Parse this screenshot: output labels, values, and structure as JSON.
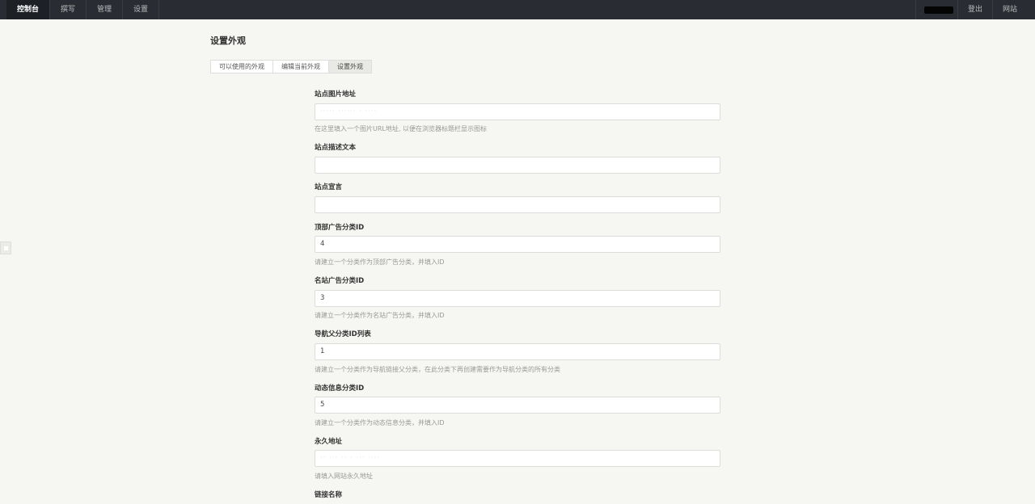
{
  "nav": {
    "left": [
      "控制台",
      "撰写",
      "管理",
      "设置"
    ],
    "right": [
      "登出",
      "网站"
    ]
  },
  "page": {
    "title": "设置外观",
    "tabs": [
      "可以使用的外观",
      "编辑当前外观",
      "设置外观"
    ],
    "active_tab": "设置外观"
  },
  "form": {
    "fields": [
      {
        "label": "站点图片地址",
        "value": "",
        "help": "在这里填入一个图片URL地址, 以便在浏览器标题栏显示图标"
      },
      {
        "label": "站点描述文本",
        "value": "",
        "help": ""
      },
      {
        "label": "站点宣言",
        "value": "",
        "help": ""
      },
      {
        "label": "顶部广告分类ID",
        "value": "4",
        "help": "请建立一个分类作为顶部广告分类，并填入ID"
      },
      {
        "label": "名站广告分类ID",
        "value": "3",
        "help": "请建立一个分类作为名站广告分类，并填入ID"
      },
      {
        "label": "导航父分类ID列表",
        "value": "1",
        "help": "请建立一个分类作为导航链接父分类，在此分类下再创建需要作为导航分类的所有分类"
      },
      {
        "label": "动态信息分类ID",
        "value": "5",
        "help": "请建立一个分类作为动态信息分类，并填入ID"
      },
      {
        "label": "永久地址",
        "value": "",
        "help": "请填入网站永久地址"
      },
      {
        "label": "链接名称",
        "value": "",
        "help": ""
      }
    ]
  },
  "colors": {
    "topbar": "#292d33",
    "background": "#f6f6f3"
  }
}
